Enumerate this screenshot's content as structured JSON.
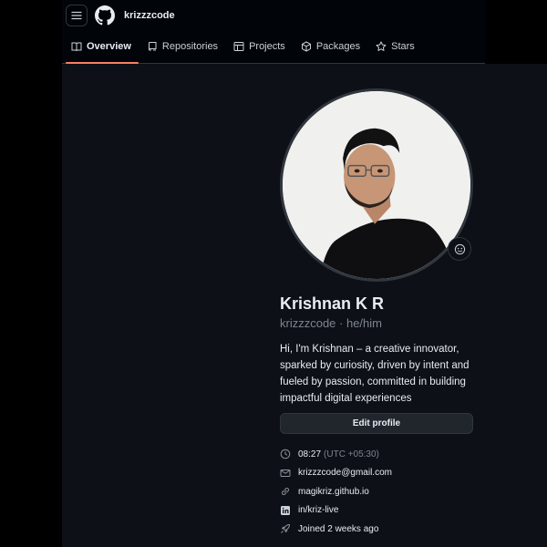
{
  "header": {
    "username": "krizzzcode",
    "tabs": [
      {
        "label": "Overview",
        "icon": "book-icon",
        "active": true
      },
      {
        "label": "Repositories",
        "icon": "repo-icon",
        "active": false
      },
      {
        "label": "Projects",
        "icon": "table-icon",
        "active": false
      },
      {
        "label": "Packages",
        "icon": "package-icon",
        "active": false
      },
      {
        "label": "Stars",
        "icon": "star-icon",
        "active": false
      }
    ]
  },
  "profile": {
    "name": "Krishnan K R",
    "handle": "krizzzcode · he/him",
    "bio": "Hi, I'm Krishnan – a creative innovator, sparked by curiosity, driven by intent and fueled by passion, committed in building impactful digital experiences",
    "edit_label": "Edit profile",
    "details": {
      "time": "08:27",
      "timezone": "(UTC +05:30)",
      "email": "krizzzcode@gmail.com",
      "website": "magikriz.github.io",
      "linkedin": "in/kriz-live",
      "joined": "Joined 2 weeks ago"
    }
  },
  "colors": {
    "background": "#0d1016",
    "accent_underline": "#f78166",
    "muted": "#7d8590",
    "button_bg": "#21262d"
  }
}
